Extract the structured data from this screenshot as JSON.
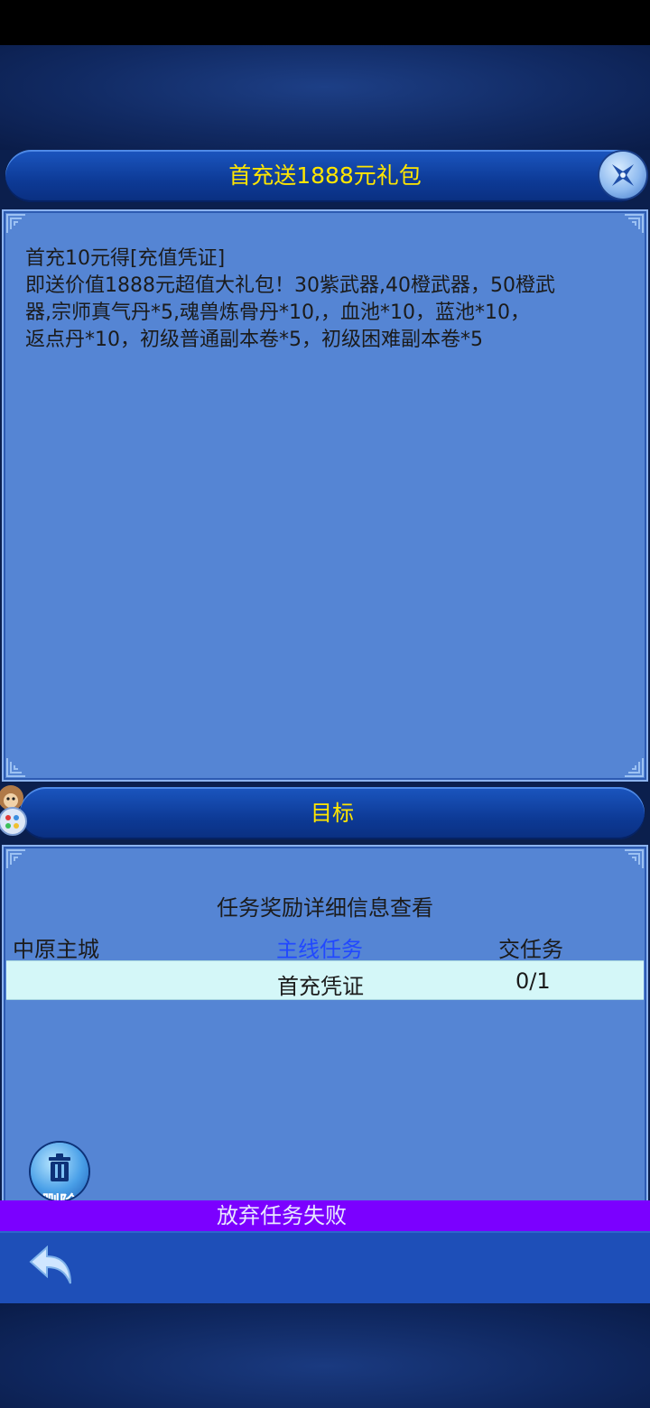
{
  "dialog": {
    "title": "首充送1888元礼包",
    "description_lines": [
      "首充10元得[充值凭证]",
      "即送价值1888元超值大礼包！30紫武器,40橙武器，50橙武",
      "器,宗师真气丹*5,魂兽炼骨丹*10,，血池*10，蓝池*10，",
      "返点丹*10，初级普通副本卷*5，初级困难副本卷*5"
    ]
  },
  "target_section": {
    "label": "目标",
    "details_title": "任务奖励详细信息查看",
    "header": {
      "location": "中原主城",
      "task_type": "主线任务",
      "action": "交任务"
    },
    "rows": [
      {
        "name": "首充凭证",
        "progress": "0/1"
      }
    ]
  },
  "delete_button": {
    "label": "删除"
  },
  "toast": {
    "message": "放弃任务失败"
  },
  "colors": {
    "title_text": "#ffe600",
    "panel_bg": "#5585d4",
    "task_type_text": "#2148ff",
    "row_highlight": "#d4f7f8",
    "toast_bg": "#7b00ff"
  },
  "icons": {
    "close": "close-icon",
    "trash": "trash-icon",
    "back": "back-arrow-icon",
    "avatar": "monkey-avatar-icon"
  }
}
